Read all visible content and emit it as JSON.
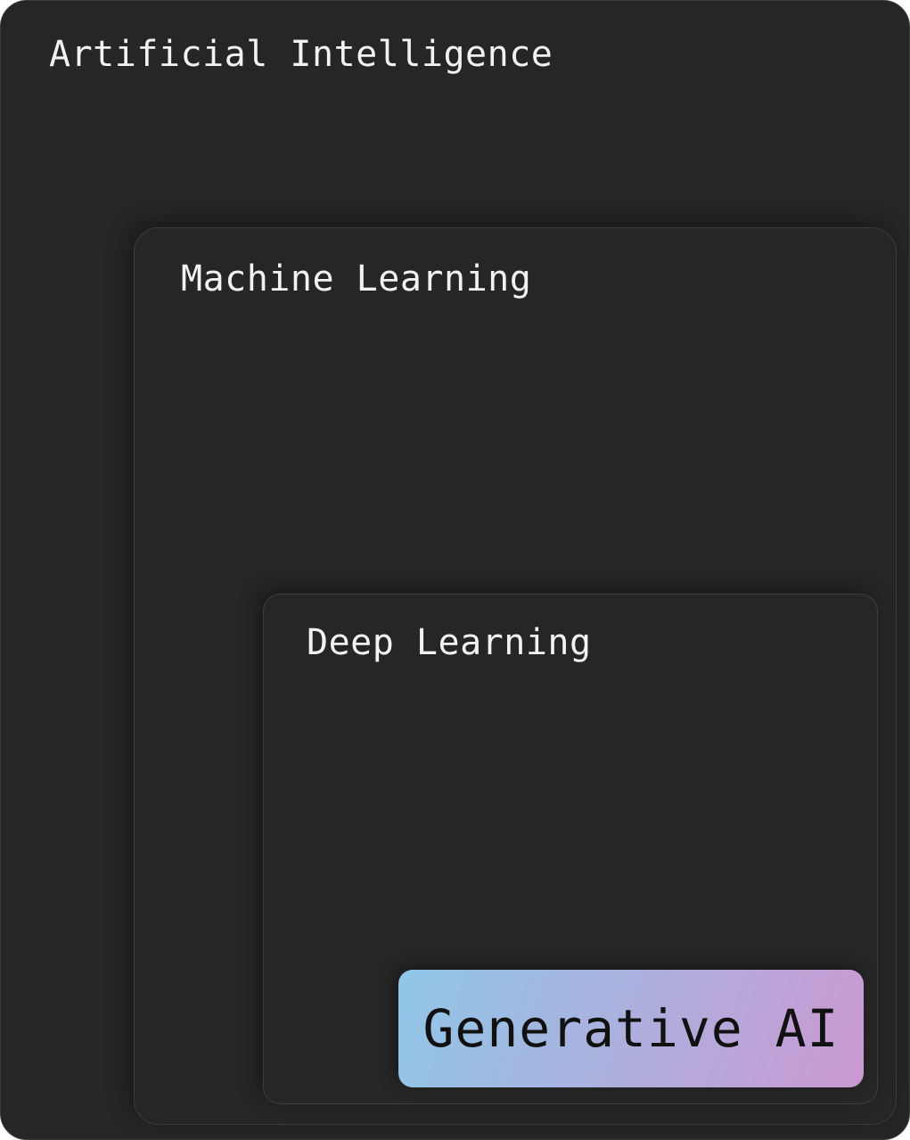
{
  "layers": {
    "artificial_intelligence": {
      "label": "Artificial Intelligence"
    },
    "machine_learning": {
      "label": "Machine Learning"
    },
    "deep_learning": {
      "label": "Deep Learning"
    },
    "generative_ai": {
      "label": "Generative AI",
      "gradient_start": "#8fc7e8",
      "gradient_end": "#cb98d2"
    }
  },
  "colors": {
    "box_background": "#262626",
    "box_text": "#f2f2f2",
    "generative_text": "#111111"
  }
}
